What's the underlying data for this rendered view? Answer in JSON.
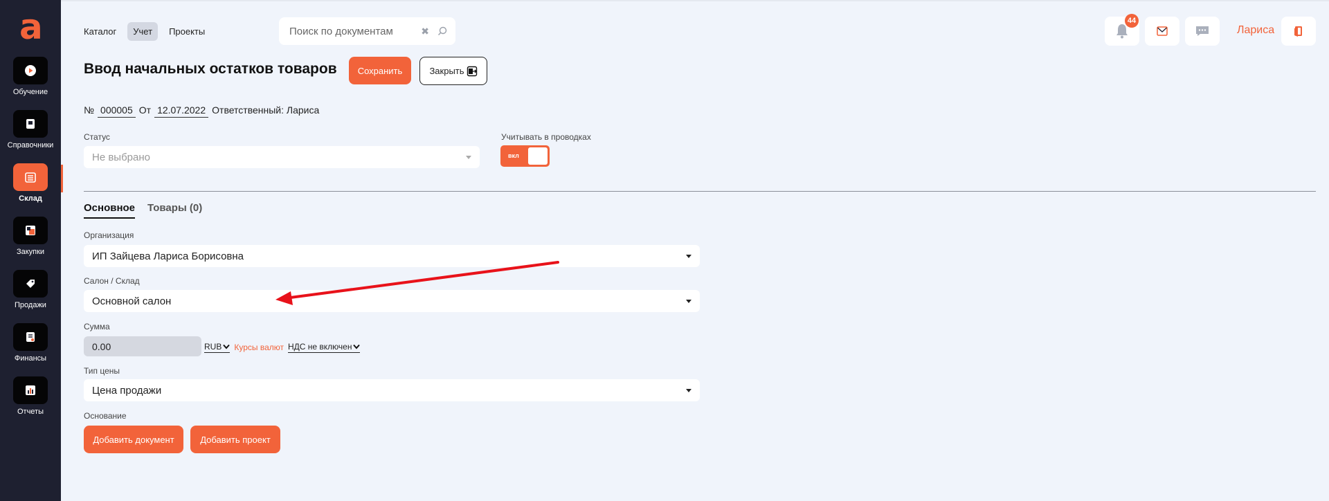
{
  "sidebar": {
    "items": [
      {
        "label": "Обучение"
      },
      {
        "label": "Справочники"
      },
      {
        "label": "Склад"
      },
      {
        "label": "Закупки"
      },
      {
        "label": "Продажи"
      },
      {
        "label": "Финансы"
      },
      {
        "label": "Отчеты"
      }
    ],
    "logo": "a"
  },
  "topnav": {
    "tabs": [
      {
        "label": "Каталог"
      },
      {
        "label": "Учет"
      },
      {
        "label": "Проекты"
      }
    ]
  },
  "search": {
    "placeholder": "Поиск по документам"
  },
  "notifications": {
    "count": "44"
  },
  "user": {
    "name": "Лариса"
  },
  "header": {
    "title": "Ввод начальных остатков товаров",
    "save_label": "Сохранить",
    "close_label": "Закрыть"
  },
  "doc": {
    "number_prefix": "№",
    "number": "000005",
    "date_prefix": "От",
    "date": "12.07.2022",
    "responsible": "Ответственный: Лариса"
  },
  "status": {
    "label": "Статус",
    "value": "Не выбрано"
  },
  "posting": {
    "label": "Учитывать в проводках",
    "toggle_text": "вкл"
  },
  "tabs": [
    {
      "label": "Основное"
    },
    {
      "label": "Товары (0)"
    }
  ],
  "form": {
    "organization": {
      "label": "Организация",
      "value": "ИП Зайцева Лариса Борисовна"
    },
    "warehouse": {
      "label": "Салон / Склад",
      "value": "Основной салон"
    },
    "amount": {
      "label": "Сумма",
      "value": "0.00",
      "currency": "RUB",
      "rates_link": "Курсы валют",
      "vat": "НДС не включен"
    },
    "price_type": {
      "label": "Тип цены",
      "value": "Цена продажи"
    },
    "basis": {
      "label": "Основание",
      "add_document": "Добавить документ",
      "add_project": "Добавить проект"
    }
  },
  "colors": {
    "accent": "#f2633a",
    "sidebar": "#1e2030",
    "background": "#f0f4fb",
    "annotation_arrow": "#e8121a"
  }
}
